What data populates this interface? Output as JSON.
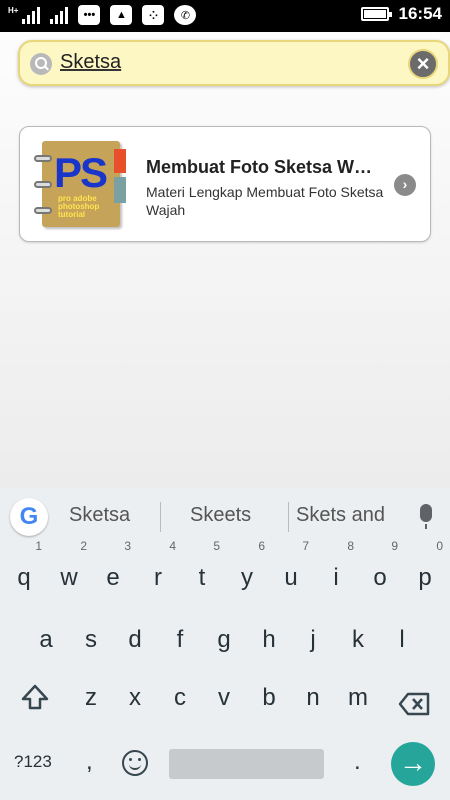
{
  "status_bar": {
    "network_label_1": "H+",
    "time": "16:54",
    "app_icons": [
      "messages-icon",
      "gallery-icon",
      "bbm-icon",
      "whatsapp-icon"
    ]
  },
  "search": {
    "query": "Sketsa"
  },
  "results": [
    {
      "title": "Membuat Foto Sketsa W…",
      "subtitle": "Materi Lengkap Membuat Foto Sketsa Wajah",
      "thumb_text": "PS",
      "thumb_caption": "pro adobe photoshop tutorial"
    }
  ],
  "keyboard": {
    "suggestions": [
      "Sketsa",
      "Skeets",
      "Skets and"
    ],
    "row1": [
      {
        "key": "q",
        "hint": "1"
      },
      {
        "key": "w",
        "hint": "2"
      },
      {
        "key": "e",
        "hint": "3"
      },
      {
        "key": "r",
        "hint": "4"
      },
      {
        "key": "t",
        "hint": "5"
      },
      {
        "key": "y",
        "hint": "6"
      },
      {
        "key": "u",
        "hint": "7"
      },
      {
        "key": "i",
        "hint": "8"
      },
      {
        "key": "o",
        "hint": "9"
      },
      {
        "key": "p",
        "hint": "0"
      }
    ],
    "row2": [
      "a",
      "s",
      "d",
      "f",
      "g",
      "h",
      "j",
      "k",
      "l"
    ],
    "row3": [
      "z",
      "x",
      "c",
      "v",
      "b",
      "n",
      "m"
    ],
    "symbols_label": "?123",
    "comma": ",",
    "period": ".",
    "enter_symbol": "→",
    "accent_color": "#26a69a"
  }
}
